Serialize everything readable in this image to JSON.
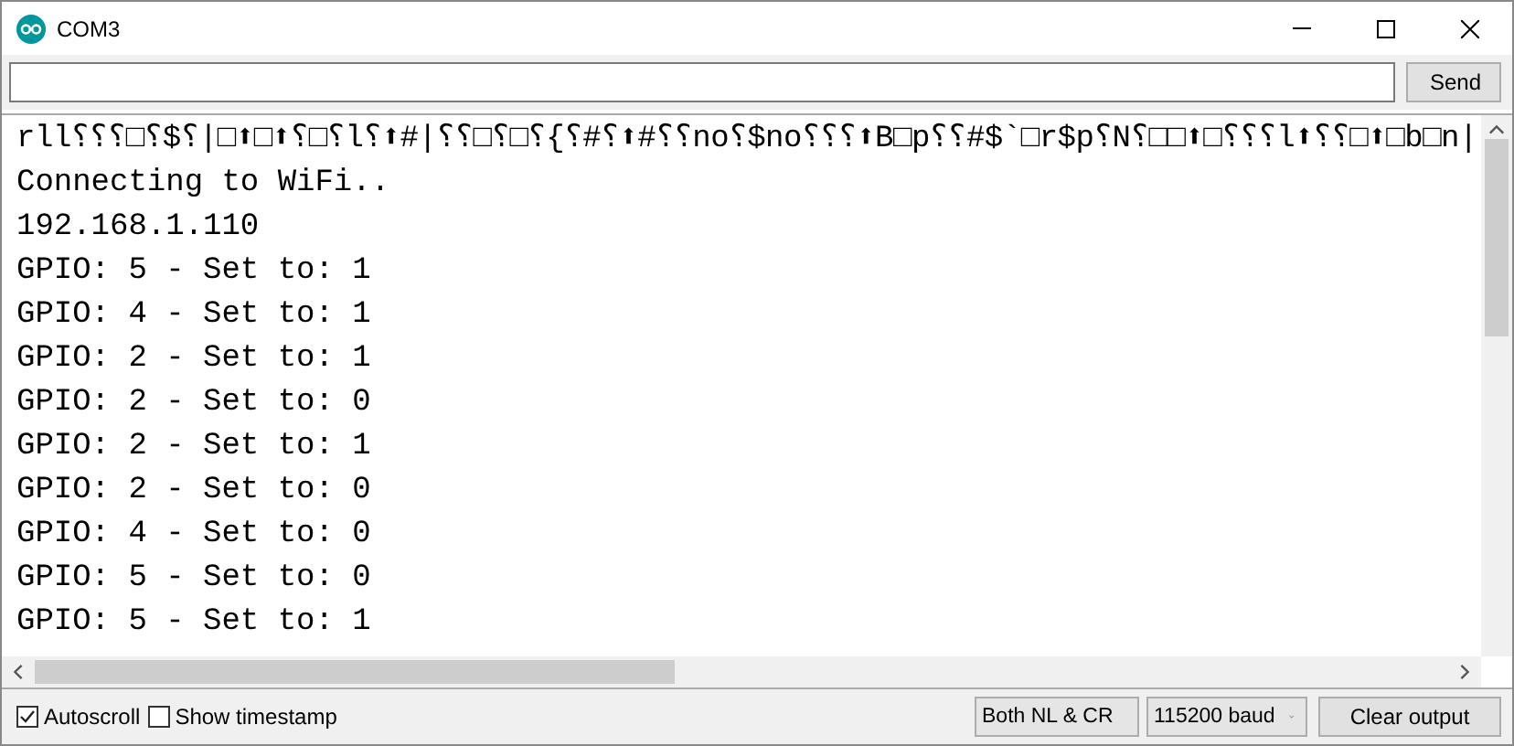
{
  "window": {
    "title": "COM3"
  },
  "send_button": "Send",
  "output_lines": [
    "rll⸮⸮⸮□⸮$⸮|□⬆□⬆⸮□⸮l⸮⬆#|⸮⸮□⸮□⸮{⸮#⸮⬆#⸮⸮no⸮$no⸮⸮⸮⬆B□p⸮⸮#$`□r$p⸮N⸮□□⬆□⸮⸮⸮l⬆⸮⸮□⬆□b□n|",
    "Connecting to WiFi..",
    "192.168.1.110",
    "GPIO: 5 - Set to: 1",
    "GPIO: 4 - Set to: 1",
    "GPIO: 2 - Set to: 1",
    "GPIO: 2 - Set to: 0",
    "GPIO: 2 - Set to: 1",
    "GPIO: 2 - Set to: 0",
    "GPIO: 4 - Set to: 0",
    "GPIO: 5 - Set to: 0",
    "GPIO: 5 - Set to: 1"
  ],
  "options": [
    {
      "label": "Autoscroll",
      "checked": true
    },
    {
      "label": "Show timestamp",
      "checked": false
    }
  ],
  "line_ending": "Both NL & CR",
  "baud_rate": "115200 baud",
  "clear_button": "Clear output"
}
